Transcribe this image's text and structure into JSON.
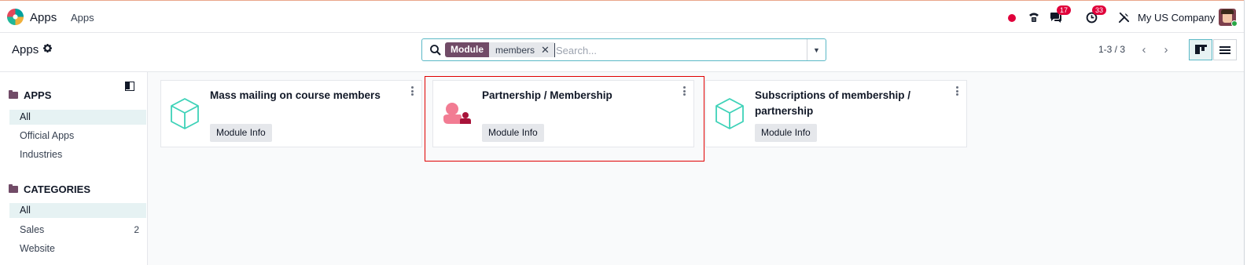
{
  "navbar": {
    "app_name": "Apps",
    "menu_item": "Apps",
    "chat_badge": "17",
    "activity_badge": "33",
    "company": "My US Company"
  },
  "control": {
    "breadcrumb": "Apps",
    "search": {
      "facet_category": "Module",
      "facet_value": "members",
      "placeholder": "Search..."
    },
    "pager": "1-3 / 3"
  },
  "sidebar": {
    "apps_section": {
      "title": "APPS",
      "items": [
        {
          "label": "All",
          "active": true
        },
        {
          "label": "Official Apps",
          "active": false
        },
        {
          "label": "Industries",
          "active": false
        }
      ]
    },
    "categories_section": {
      "title": "CATEGORIES",
      "items": [
        {
          "label": "All",
          "active": true,
          "count": ""
        },
        {
          "label": "Sales",
          "active": false,
          "count": "2"
        },
        {
          "label": "Website",
          "active": false,
          "count": ""
        }
      ]
    }
  },
  "cards": [
    {
      "title": "Mass mailing on course members",
      "button": "Module Info",
      "icon": "generic-module-cube-icon"
    },
    {
      "title": "Partnership / Membership",
      "button": "Module Info",
      "icon": "membership-app-icon"
    },
    {
      "title": "Subscriptions of membership / partnership",
      "button": "Module Info",
      "icon": "generic-module-cube-icon"
    }
  ],
  "colors": {
    "brand": "#714b67",
    "accent": "#5bb8c6",
    "badge": "#e0003b",
    "module_icon": "#3ed2b8",
    "highlight": "#e00000"
  }
}
